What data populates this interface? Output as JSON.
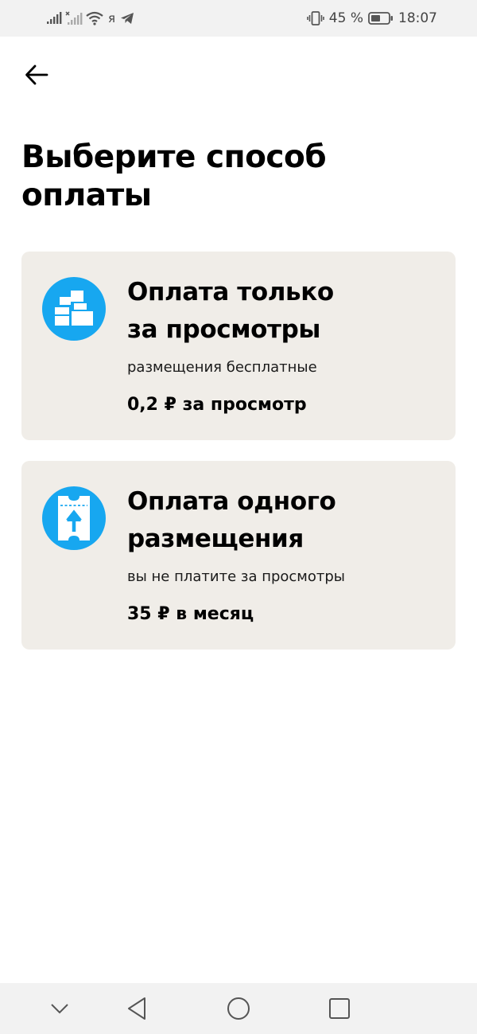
{
  "status_bar": {
    "carrier": "я",
    "battery_percent": "45 %",
    "time": "18:07",
    "icons": [
      "signal-icon",
      "signal-no-sim-icon",
      "wifi-icon",
      "telegram-icon",
      "vibrate-icon",
      "battery-icon"
    ]
  },
  "header": {
    "back_icon": "arrow-left-icon",
    "title": "Выберите способ оплаты"
  },
  "options": [
    {
      "icon": "blocks-icon",
      "title_line1": "Оплата только",
      "title_line2": "за просмотры",
      "subtitle": "размещения бесплатные",
      "price": "0,2 ₽ за просмотр"
    },
    {
      "icon": "ticket-up-icon",
      "title_line1": "Оплата одного",
      "title_line2": "размещения",
      "subtitle": "вы не платите за просмотры",
      "price": "35 ₽ в месяц"
    }
  ],
  "navigation_bar": {
    "icons": [
      "chevron-down-icon",
      "nav-back-triangle-icon",
      "nav-home-circle-icon",
      "nav-recent-square-icon"
    ]
  },
  "colors": {
    "accent": "#17a7f0",
    "card_background": "#f0ede8",
    "system_bar_background": "#f2f2f2",
    "text": "#000000"
  }
}
